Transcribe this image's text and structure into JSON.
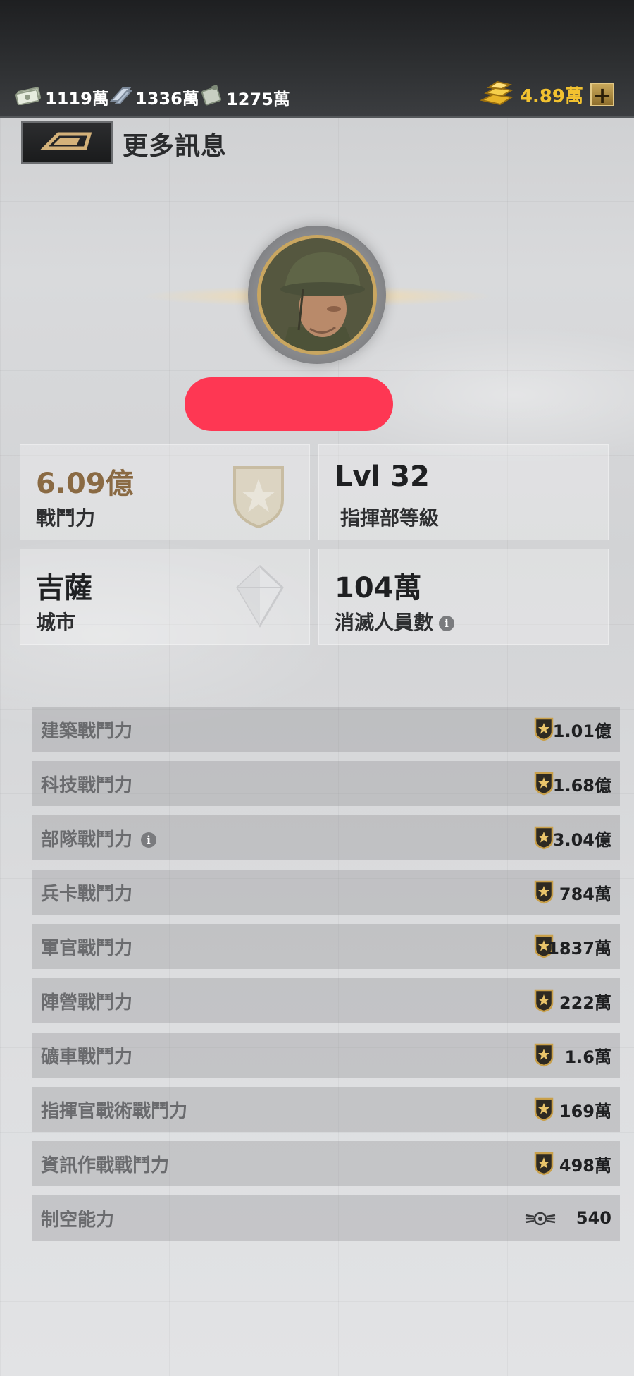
{
  "resources": {
    "cash": "1119萬",
    "steel": "1336萬",
    "oil": "1275萬",
    "gold": "4.89萬"
  },
  "header": {
    "title": "更多訊息"
  },
  "stats": {
    "power": {
      "value": "6.09億",
      "label": "戰鬥力"
    },
    "hq_level": {
      "value": "Lvl 32",
      "label": "指揮部等級"
    },
    "city": {
      "value": "吉薩",
      "label": "城市"
    },
    "kills": {
      "value": "104萬",
      "label": "消滅人員數"
    }
  },
  "breakdown": [
    {
      "label": "建築戰鬥力",
      "value": "1.01億",
      "icon": "star-shield-icon"
    },
    {
      "label": "科技戰鬥力",
      "value": "1.68億",
      "icon": "star-shield-icon"
    },
    {
      "label": "部隊戰鬥力",
      "value": "3.04億",
      "icon": "star-shield-icon",
      "info": true
    },
    {
      "label": "兵卡戰鬥力",
      "value": "784萬",
      "icon": "star-shield-icon"
    },
    {
      "label": "軍官戰鬥力",
      "value": "1837萬",
      "icon": "star-shield-icon"
    },
    {
      "label": "陣營戰鬥力",
      "value": "222萬",
      "icon": "star-shield-icon"
    },
    {
      "label": "礦車戰鬥力",
      "value": "1.6萬",
      "icon": "star-shield-icon"
    },
    {
      "label": "指揮官戰術戰鬥力",
      "value": "169萬",
      "icon": "star-shield-icon"
    },
    {
      "label": "資訊作戰戰鬥力",
      "value": "498萬",
      "icon": "star-shield-icon"
    },
    {
      "label": "制空能力",
      "value": "540",
      "icon": "winged-target-icon"
    }
  ],
  "colors": {
    "gold_text": "#f2c230",
    "power_text": "#8a6a43",
    "redaction": "#fe3753",
    "badge_gold": "#c9a04a"
  }
}
